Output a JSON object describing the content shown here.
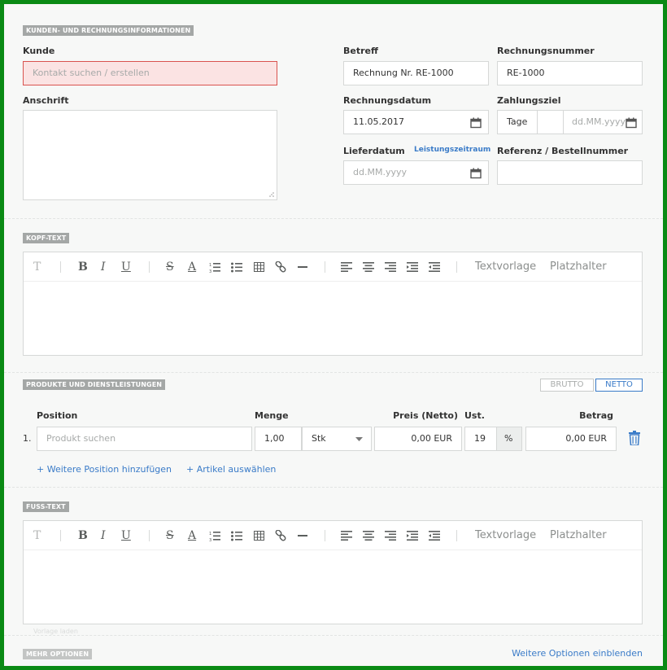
{
  "sections": {
    "customer": "KUNDEN- UND RECHNUNGSINFORMATIONEN",
    "header_text": "KOPF-TEXT",
    "products": "PRODUKTE UND DIENSTLEISTUNGEN",
    "footer_text": "FUSS-TEXT",
    "more_options": "MEHR OPTIONEN"
  },
  "customer": {
    "kunde_label": "Kunde",
    "kunde_placeholder": "Kontakt suchen / erstellen",
    "anschrift_label": "Anschrift"
  },
  "invoice": {
    "betreff_label": "Betreff",
    "betreff_value": "Rechnung Nr. RE-1000",
    "nummer_label": "Rechnungsnummer",
    "nummer_value": "RE-1000",
    "datum_label": "Rechnungsdatum",
    "datum_value": "11.05.2017",
    "zahlungsziel_label": "Zahlungsziel",
    "tage_label": "Tage",
    "zahlungsziel_placeholder": "dd.MM.yyyy",
    "lieferdatum_label": "Lieferdatum",
    "leistungszeitraum_link": "Leistungszeitraum",
    "lieferdatum_placeholder": "dd.MM.yyyy",
    "referenz_label": "Referenz / Bestellnummer"
  },
  "editor_toolbar": {
    "textvorlage": "Textvorlage",
    "platzhalter": "Platzhalter"
  },
  "products": {
    "brutto": "BRUTTO",
    "netto": "NETTO",
    "columns": {
      "position": "Position",
      "menge": "Menge",
      "preis": "Preis (Netto)",
      "ust": "Ust.",
      "betrag": "Betrag"
    },
    "rows": [
      {
        "index": "1.",
        "product_placeholder": "Produkt suchen",
        "menge": "1,00",
        "unit": "Stk",
        "preis": "0,00 EUR",
        "ust": "19",
        "ust_unit": "%",
        "betrag": "0,00 EUR"
      }
    ],
    "add_position": "+ Weitere Position hinzufügen",
    "select_article": "+ Artikel auswählen"
  },
  "footer": {
    "faint_text": "Vorlage laden"
  },
  "more": {
    "show_link": "Weitere Optionen einblenden"
  },
  "colors": {
    "frame_border": "#0a8a14",
    "background": "#f7f8f7",
    "section_tag": "#a4a7a6",
    "link": "#3a7bc8",
    "error_bg": "#fbe3e3",
    "error_border": "#d9534f"
  }
}
